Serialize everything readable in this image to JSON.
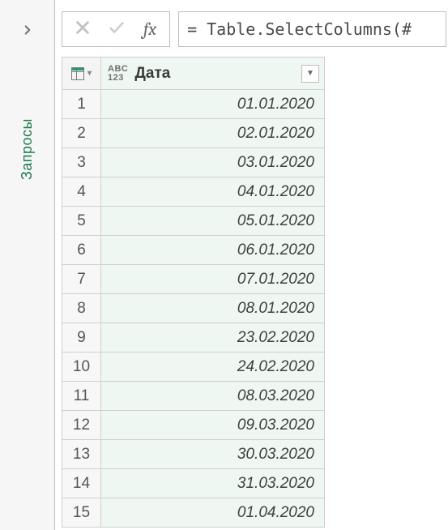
{
  "sidebar": {
    "label": "Запросы"
  },
  "formula_bar": {
    "fx_label": "fx",
    "formula": "= Table.SelectColumns(#"
  },
  "table": {
    "columns": [
      {
        "name": "Дата",
        "type_label_top": "ABC",
        "type_label_bottom": "123"
      }
    ],
    "rows": [
      {
        "n": "1",
        "v": "01.01.2020"
      },
      {
        "n": "2",
        "v": "02.01.2020"
      },
      {
        "n": "3",
        "v": "03.01.2020"
      },
      {
        "n": "4",
        "v": "04.01.2020"
      },
      {
        "n": "5",
        "v": "05.01.2020"
      },
      {
        "n": "6",
        "v": "06.01.2020"
      },
      {
        "n": "7",
        "v": "07.01.2020"
      },
      {
        "n": "8",
        "v": "08.01.2020"
      },
      {
        "n": "9",
        "v": "23.02.2020"
      },
      {
        "n": "10",
        "v": "24.02.2020"
      },
      {
        "n": "11",
        "v": "08.03.2020"
      },
      {
        "n": "12",
        "v": "09.03.2020"
      },
      {
        "n": "13",
        "v": "30.03.2020"
      },
      {
        "n": "14",
        "v": "31.03.2020"
      },
      {
        "n": "15",
        "v": "01.04.2020"
      }
    ]
  }
}
